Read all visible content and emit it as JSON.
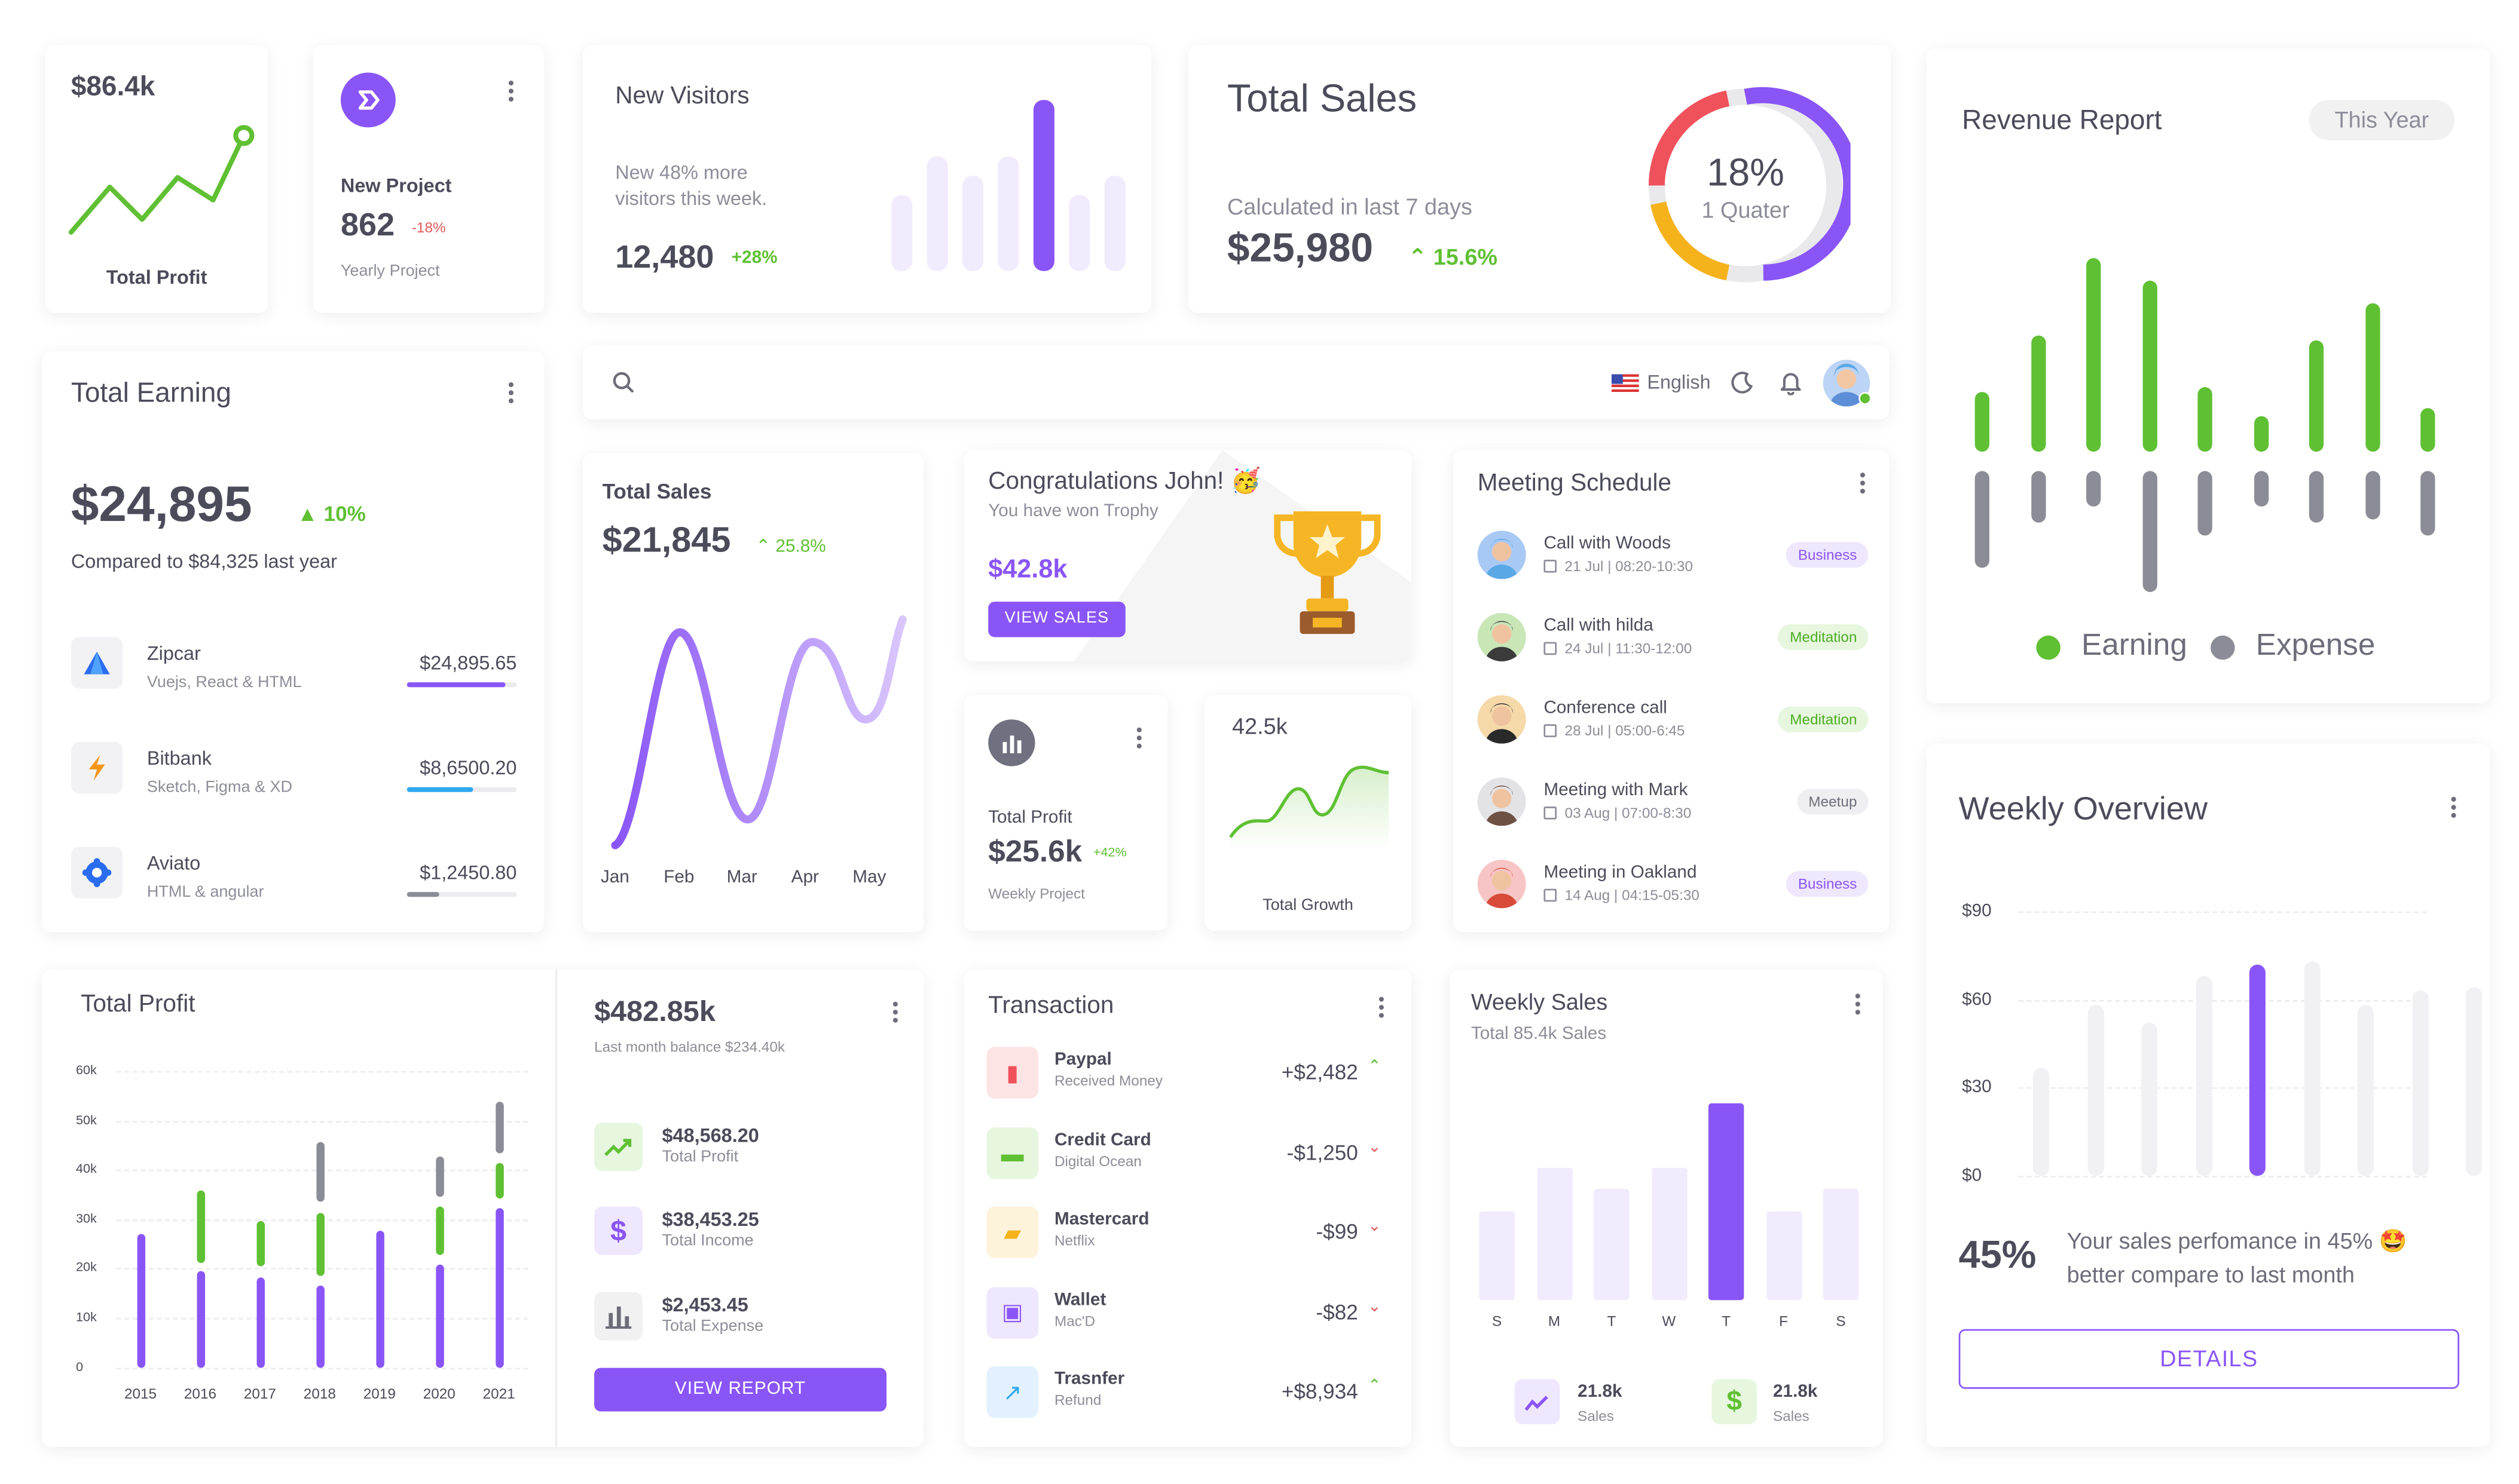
{
  "profit_mini": {
    "amount": "$86.4k",
    "label": "Total Profit"
  },
  "new_project": {
    "title": "New Project",
    "value": "862",
    "change": "-18%",
    "subtitle": "Yearly Project"
  },
  "new_visitors": {
    "title": "New Visitors",
    "line1": "New 48% more",
    "line2": "visitors this week.",
    "value": "12,480",
    "change": "+28%"
  },
  "total_sales_top": {
    "title": "Total Sales",
    "subtitle": "Calculated in last 7 days",
    "value": "$25,980",
    "change": "15.6%",
    "ring_percent": "18%",
    "ring_label": "1 Quater"
  },
  "revenue_report": {
    "title": "Revenue Report",
    "period": "This Year",
    "legend_earning": "Earning",
    "legend_expense": "Expense",
    "earning": [
      37,
      72,
      120,
      106,
      40,
      22,
      69,
      92,
      27
    ],
    "expense": [
      60,
      32,
      22,
      75,
      40,
      22,
      32,
      30,
      40
    ]
  },
  "total_earning": {
    "title": "Total Earning",
    "amount": "$24,895",
    "change": "10%",
    "compare": "Compared to $84,325 last year",
    "items": [
      {
        "name": "Zipcar",
        "sub": "Vuejs, React & HTML",
        "amount": "$24,895.65",
        "progress": 0.9,
        "color": "#8a55f7"
      },
      {
        "name": "Bitbank",
        "sub": "Sketch, Figma & XD",
        "amount": "$8,6500.20",
        "progress": 0.6,
        "color": "#2fa8ef"
      },
      {
        "name": "Aviato",
        "sub": "HTML & angular",
        "amount": "$1,2450.80",
        "progress": 0.3,
        "color": "#8c8c96"
      }
    ]
  },
  "navbar": {
    "language": "English"
  },
  "total_sales_chart": {
    "title": "Total Sales",
    "value": "$21,845",
    "change": "25.8%",
    "months": [
      "Jan",
      "Feb",
      "Mar",
      "Apr",
      "May"
    ]
  },
  "congrats": {
    "title": "Congratulations John! 🥳",
    "subtitle": "You have won Trophy",
    "amount": "$42.8k",
    "button": "VIEW SALES"
  },
  "profit_card": {
    "label": "Total Profit",
    "value": "$25.6k",
    "change": "+42%",
    "sub": "Weekly Project"
  },
  "growth_card": {
    "value": "42.5k",
    "label": "Total Growth"
  },
  "meetings": {
    "title": "Meeting Schedule",
    "items": [
      {
        "title": "Call with Woods",
        "date": "21 Jul | 08:20-10:30",
        "tag": "Business",
        "tag_color": "#8a55f7",
        "tag_bg": "#efe7fe"
      },
      {
        "title": "Call with hilda",
        "date": "24 Jul | 11:30-12:00",
        "tag": "Meditation",
        "tag_color": "#4cae22",
        "tag_bg": "#e7f6df"
      },
      {
        "title": "Conference call",
        "date": "28 Jul | 05:00-6:45",
        "tag": "Meditation",
        "tag_color": "#4cae22",
        "tag_bg": "#e7f6df"
      },
      {
        "title": "Meeting with Mark",
        "date": "03 Aug | 07:00-8:30",
        "tag": "Meetup",
        "tag_color": "#6d6d7a",
        "tag_bg": "#efeff1"
      },
      {
        "title": "Meeting in Oakland",
        "date": "14 Aug | 04:15-05:30",
        "tag": "Business",
        "tag_color": "#8a55f7",
        "tag_bg": "#efe7fe"
      }
    ]
  },
  "weekly_overview": {
    "title": "Weekly Overview",
    "y_labels": [
      "$90",
      "$60",
      "$30",
      "$0"
    ],
    "values": [
      37,
      58,
      52,
      68,
      72,
      73,
      58,
      63,
      64
    ],
    "highlight_index": 4,
    "percent": "45%",
    "text1": "Your sales perfomance in 45% 🤩",
    "text2": "better compare to last month",
    "button": "DETAILS"
  },
  "total_profit": {
    "title": "Total Profit",
    "y_labels": [
      "60k",
      "50k",
      "40k",
      "30k",
      "20k",
      "10k",
      "0"
    ],
    "years": [
      "2015",
      "2016",
      "2017",
      "2018",
      "2019",
      "2020",
      "2021"
    ]
  },
  "balance": {
    "amount": "$482.85k",
    "subtitle": "Last month balance $234.40k",
    "items": [
      {
        "value": "$48,568.20",
        "label": "Total Profit"
      },
      {
        "value": "$38,453.25",
        "label": "Total Income"
      },
      {
        "value": "$2,453.45",
        "label": "Total Expense"
      }
    ],
    "button": "VIEW REPORT"
  },
  "transactions": {
    "title": "Transaction",
    "items": [
      {
        "name": "Paypal",
        "sub": "Received Money",
        "amount": "+$2,482"
      },
      {
        "name": "Credit Card",
        "sub": "Digital Ocean",
        "amount": "-$1,250"
      },
      {
        "name": "Mastercard",
        "sub": "Netflix",
        "amount": "-$99"
      },
      {
        "name": "Wallet",
        "sub": "Mac'D",
        "amount": "-$82"
      },
      {
        "name": "Trasnfer",
        "sub": "Refund",
        "amount": "+$8,934"
      }
    ]
  },
  "weekly_sales": {
    "title": "Weekly Sales",
    "subtitle": "Total 85.4k Sales",
    "days": [
      "S",
      "M",
      "T",
      "W",
      "T",
      "F",
      "S"
    ],
    "stat1_value": "21.8k",
    "stat1_label": "Sales",
    "stat2_value": "21.8k",
    "stat2_label": "Sales"
  }
}
